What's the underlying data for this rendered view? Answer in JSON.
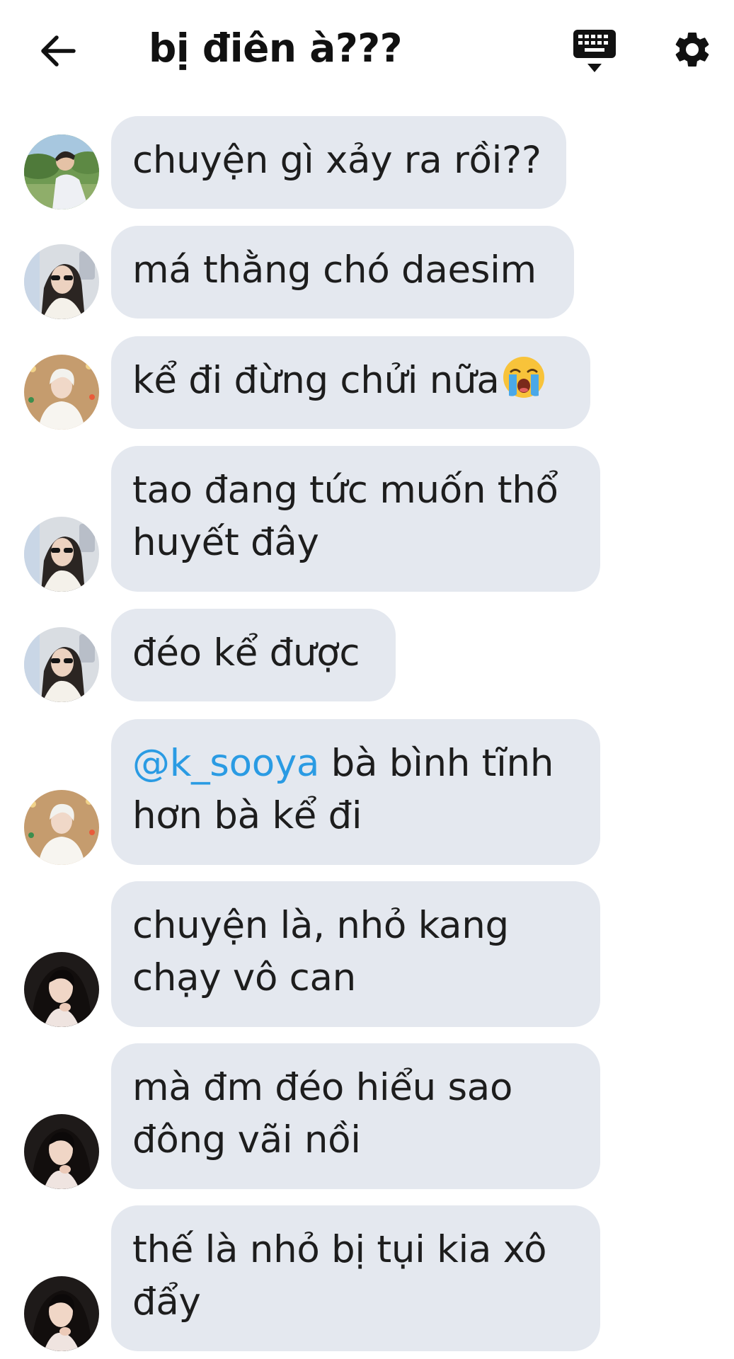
{
  "header": {
    "title": "bị điên à???",
    "back_icon": "arrow-left-icon",
    "keyboard_icon": "keyboard-icon",
    "settings_icon": "gear-icon"
  },
  "colors": {
    "bubble": "#e4e8ef",
    "mention": "#2a9be3",
    "text": "#1d1d1d"
  },
  "messages": [
    {
      "sender_avatar": "avatar-boy-outdoor",
      "text": "chuyện gì xảy ra rồi??"
    },
    {
      "sender_avatar": "avatar-girl-sunglasses",
      "text": "má thằng chó daesim"
    },
    {
      "sender_avatar": "avatar-boy-white-hair",
      "text": "kể đi đừng chửi nữa",
      "emoji": "loudly-crying-face-icon"
    },
    {
      "sender_avatar": "avatar-girl-sunglasses",
      "line1": "tao đang tức muốn thổ",
      "line2": "huyết đây"
    },
    {
      "sender_avatar": "avatar-girl-sunglasses",
      "text": "đéo kể được"
    },
    {
      "sender_avatar": "avatar-boy-white-hair",
      "mention": "@k_sooya",
      "line1_rest": " bà bình tĩnh",
      "line2": "hơn bà kể đi"
    },
    {
      "sender_avatar": "avatar-girl-dark-hair",
      "line1": "chuyện là, nhỏ kang",
      "line2": "chạy vô can"
    },
    {
      "sender_avatar": "avatar-girl-dark-hair",
      "line1": "mà đm đéo hiểu sao",
      "line2": "đông vãi nồi"
    },
    {
      "sender_avatar": "avatar-girl-dark-hair",
      "line1": "thế là nhỏ bị tụi kia xô",
      "line2": "đẩy"
    }
  ]
}
